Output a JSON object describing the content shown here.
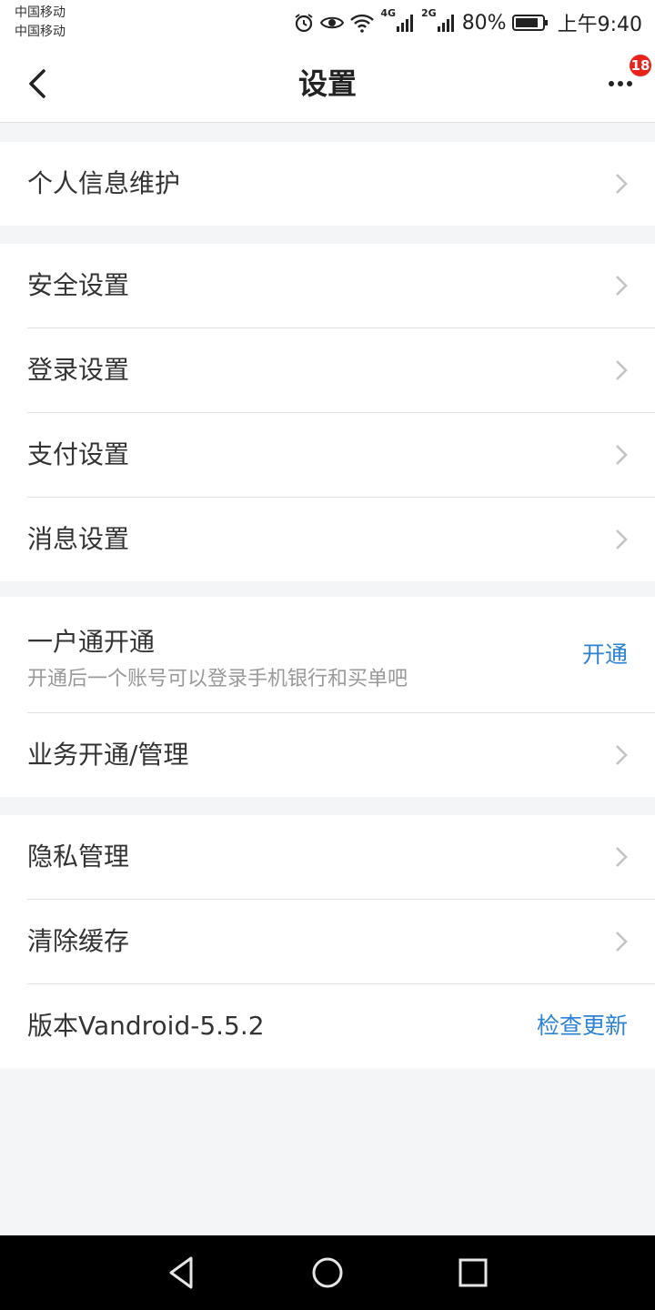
{
  "status_bar": {
    "carrier_1": "中国移动",
    "carrier_2": "中国移动",
    "net_1": "4G",
    "net_2": "2G",
    "battery": "80%",
    "time": "上午9:40",
    "icons": [
      "alarm-icon",
      "eye-icon",
      "wifi-icon",
      "signal-icon",
      "battery-icon"
    ]
  },
  "nav": {
    "title": "设置",
    "back_icon": "chevron-left-icon",
    "more_icon": "more-dots-icon",
    "badge_count": "18"
  },
  "groups": [
    {
      "items": [
        {
          "label": "个人信息维护"
        }
      ]
    },
    {
      "items": [
        {
          "label": "安全设置"
        },
        {
          "label": "登录设置"
        },
        {
          "label": "支付设置"
        },
        {
          "label": "消息设置"
        }
      ]
    },
    {
      "items": [
        {
          "label": "一户通开通",
          "sub": "开通后一个账号可以登录手机银行和买单吧",
          "action": "开通"
        },
        {
          "label": "业务开通/管理"
        }
      ]
    },
    {
      "items": [
        {
          "label": "隐私管理"
        },
        {
          "label": "清除缓存"
        },
        {
          "label": "版本Vandroid-5.5.2",
          "action": "检查更新"
        }
      ]
    }
  ],
  "colors": {
    "accent": "#2b82d9",
    "badge": "#e8231c",
    "background": "#f4f5f7"
  },
  "system_nav": {
    "icons": [
      "back-triangle-icon",
      "home-circle-icon",
      "recents-square-icon"
    ]
  }
}
